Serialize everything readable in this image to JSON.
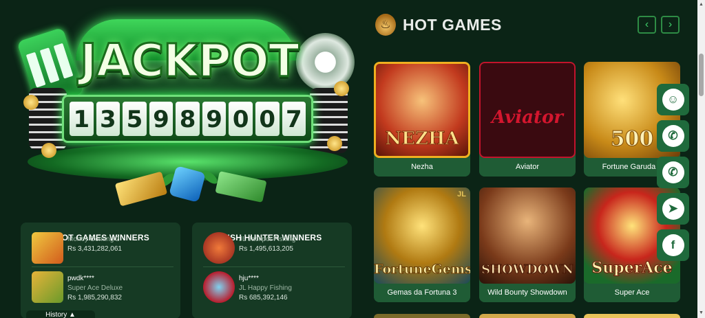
{
  "jackpot": {
    "title": "JACKPOT",
    "digits": [
      "1",
      "3",
      "5",
      "9",
      "8",
      "9",
      "0",
      "0",
      "7"
    ]
  },
  "slot_winners": {
    "title": "SLOT GAMES WINNERS",
    "items": [
      {
        "user": "",
        "game": "Money Coming 2",
        "amount": "Rs 3,431,282,061"
      },
      {
        "user": "pwdk****",
        "game": "Super Ace Deluxe",
        "amount": "Rs 1,985,290,832"
      }
    ]
  },
  "fish_winners": {
    "title": "FISH HUNTER WINNERS",
    "items": [
      {
        "user": "",
        "game": "JL Jackpot Fishing",
        "amount": "Rs 1,495,613,205"
      },
      {
        "user": "hju****",
        "game": "JL Happy Fishing",
        "amount": "Rs 685,392,146"
      }
    ]
  },
  "history_tab": "History ▲",
  "hot_games": {
    "title": "HOT GAMES",
    "prev_icon": "chevron-left-icon",
    "next_icon": "chevron-right-icon",
    "games": [
      {
        "name": "Nezha",
        "art": "NEZHA"
      },
      {
        "name": "Aviator",
        "art": "Aviator"
      },
      {
        "name": "Fortune Garuda 5",
        "art": "500"
      },
      {
        "name": "Gemas da Fortuna 3",
        "art": "FortuneGems3"
      },
      {
        "name": "Wild Bounty Showdown",
        "art": "SHOWDOWN"
      },
      {
        "name": "Super Ace",
        "art": "SuperAce"
      }
    ]
  },
  "social": [
    "support-agent-icon",
    "whatsapp-icon",
    "whatsapp-icon",
    "telegram-icon",
    "facebook-icon"
  ],
  "colors": {
    "background": "#0b2416",
    "panel": "#163a24",
    "card_label": "#1f5c35",
    "accent_green": "#3fd06b",
    "social_bg": "#1f6a3c"
  }
}
